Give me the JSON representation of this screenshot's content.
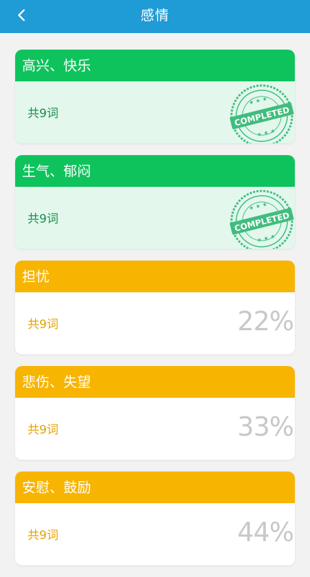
{
  "header": {
    "title": "感情",
    "back_icon": "chevron-left-icon",
    "bg_color": "#1f9bd6"
  },
  "colors": {
    "completed_header": "#0ec35c",
    "completed_body": "#e3f7ec",
    "completed_text": "#1a8c4d",
    "progress_header": "#f7b400",
    "progress_body": "#ffffff",
    "progress_text": "#e6a100",
    "stamp": "#2fb673"
  },
  "stamp_label": "COMPLETED",
  "cards": [
    {
      "title": "高兴、快乐",
      "count": "共9词",
      "status": "completed",
      "progress_label": ""
    },
    {
      "title": "生气、郁闷",
      "count": "共9词",
      "status": "completed",
      "progress_label": ""
    },
    {
      "title": "担忧",
      "count": "共9词",
      "status": "in-progress",
      "progress_label": "22%"
    },
    {
      "title": "悲伤、失望",
      "count": "共9词",
      "status": "in-progress",
      "progress_label": "33%"
    },
    {
      "title": "安慰、鼓励",
      "count": "共9词",
      "status": "in-progress",
      "progress_label": "44%"
    }
  ]
}
